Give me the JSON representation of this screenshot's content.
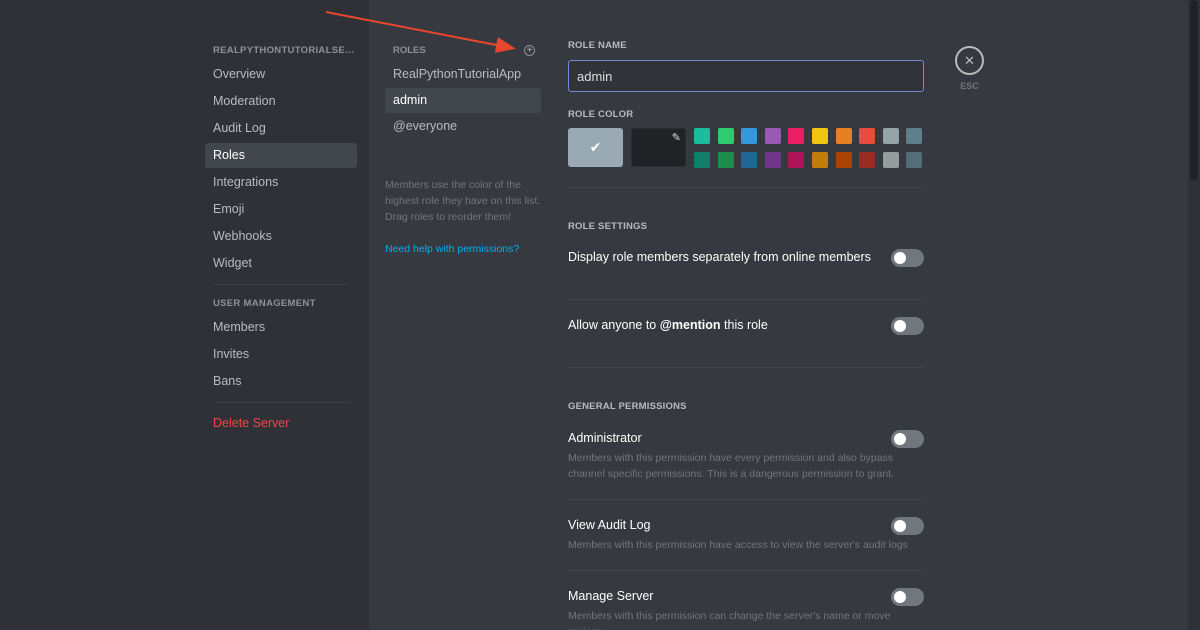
{
  "sidebar": {
    "server_name": "REALPYTHONTUTORIALSERV...",
    "items": [
      {
        "label": "Overview"
      },
      {
        "label": "Moderation"
      },
      {
        "label": "Audit Log"
      },
      {
        "label": "Roles"
      },
      {
        "label": "Integrations"
      },
      {
        "label": "Emoji"
      },
      {
        "label": "Webhooks"
      },
      {
        "label": "Widget"
      }
    ],
    "user_management_header": "USER MANAGEMENT",
    "user_items": [
      {
        "label": "Members"
      },
      {
        "label": "Invites"
      },
      {
        "label": "Bans"
      }
    ],
    "delete_label": "Delete Server"
  },
  "roles": {
    "header": "ROLES",
    "add_icon": "plus-circle-icon",
    "list": [
      {
        "label": "RealPythonTutorialApp"
      },
      {
        "label": "admin"
      },
      {
        "label": "@everyone"
      }
    ],
    "help_text": "Members use the color of the highest role they have on this list. Drag roles to reorder them!",
    "help_link": "Need help with permissions?"
  },
  "role_editor": {
    "role_name_label": "ROLE NAME",
    "role_name_value": "admin",
    "role_color_label": "ROLE COLOR",
    "default_color": "#99aab5",
    "palette_top": [
      "#1abc9c",
      "#2ecc71",
      "#3498db",
      "#9b59b6",
      "#e91e63",
      "#f1c40f",
      "#e67e22",
      "#e74c3c",
      "#95a5a6",
      "#607d8b"
    ],
    "palette_bottom": [
      "#11806a",
      "#1f8b4c",
      "#206694",
      "#71368a",
      "#ad1457",
      "#c27c0e",
      "#a84300",
      "#992d22",
      "#979c9f",
      "#546e7a"
    ],
    "settings_label": "ROLE SETTINGS",
    "settings": [
      {
        "label": "Display role members separately from online members"
      },
      {
        "label_pre": "Allow anyone to ",
        "label_bold": "@mention",
        "label_post": " this role"
      }
    ],
    "general_label": "GENERAL PERMISSIONS",
    "permissions": [
      {
        "label": "Administrator",
        "desc": "Members with this permission have every permission and also bypass channel specific permissions. This is a dangerous permission to grant."
      },
      {
        "label": "View Audit Log",
        "desc": "Members with this permission have access to view the server's audit logs"
      },
      {
        "label": "Manage Server",
        "desc": "Members with this permission can change the server's name or move regions."
      }
    ]
  },
  "close": {
    "icon": "close-icon",
    "label": "ESC"
  },
  "colors": {
    "annotation_arrow": "#e8472f"
  }
}
